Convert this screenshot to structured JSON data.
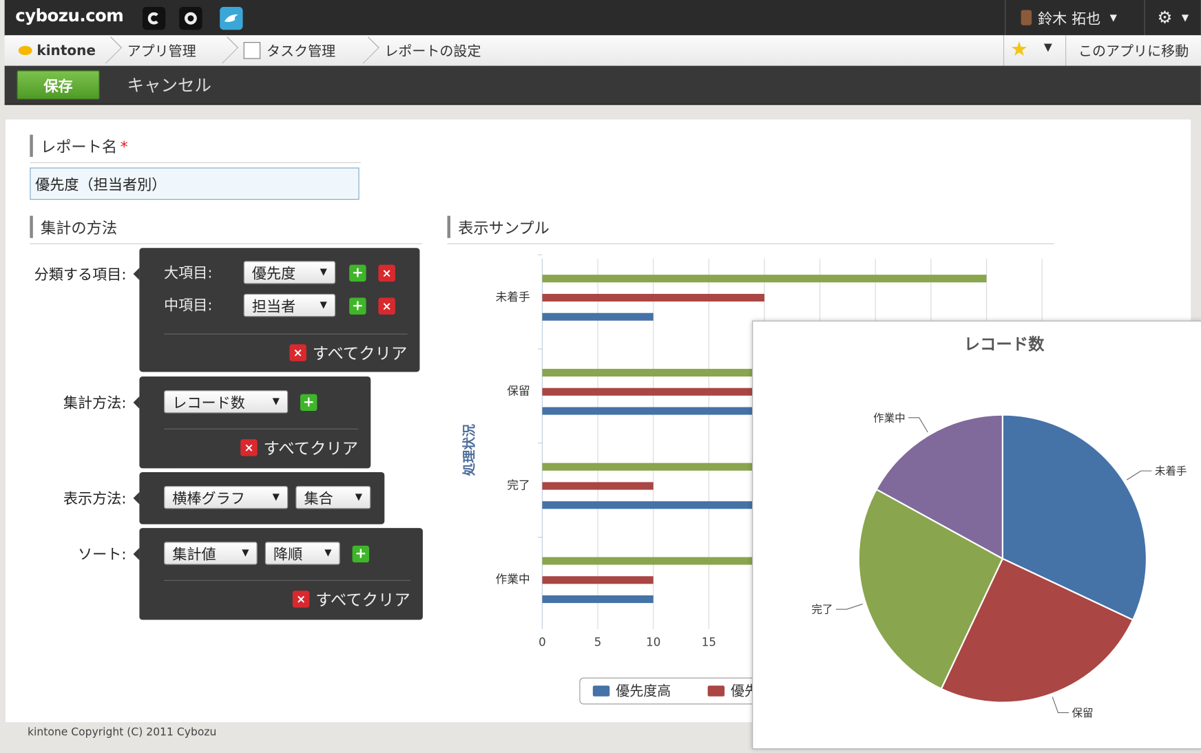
{
  "topbar": {
    "logo": "cybozu.com",
    "icons": [
      "c-icon",
      "circle-icon",
      "bird-icon"
    ],
    "user_name": "鈴木 拓也",
    "user_caret": "▼",
    "gear_symbol": "⚙",
    "gear_caret": "▼"
  },
  "breadcrumb": {
    "home": "kintone",
    "items": [
      "アプリ管理",
      "タスク管理",
      "レポートの設定"
    ],
    "star": "★",
    "star_caret": "▼",
    "goto_app": "このアプリに移動"
  },
  "actions": {
    "save": "保存",
    "cancel": "キャンセル"
  },
  "report": {
    "name_label": "レポート名",
    "required_mark": "*",
    "name_value": "優先度（担当者別）"
  },
  "aggregation": {
    "section_title": "集計の方法",
    "group_label": "分類する項目:",
    "major_label": "大項目:",
    "major_value": "優先度",
    "minor_label": "中項目:",
    "minor_value": "担当者",
    "clear_all": "すべてクリア",
    "method_label": "集計方法:",
    "method_value": "レコード数",
    "display_label": "表示方法:",
    "display_type": "横棒グラフ",
    "display_mode": "集合",
    "sort_label": "ソート:",
    "sort_field": "集計値",
    "sort_order": "降順",
    "caret": "▼",
    "plus": "+",
    "x": "×"
  },
  "sample": {
    "section_title": "表示サンプル"
  },
  "chart_data": [
    {
      "type": "bar",
      "orientation": "horizontal",
      "ylabel": "処理状況",
      "categories": [
        "未着手",
        "保留",
        "完了",
        "作業中"
      ],
      "xticks": [
        "0",
        "5",
        "10",
        "15"
      ],
      "xlim": [
        0,
        45
      ],
      "grid": true,
      "series": [
        {
          "name": "優先度高",
          "color": "#4572a7",
          "values": [
            10,
            20,
            20,
            10
          ]
        },
        {
          "name": "優先",
          "color": "#aa4643",
          "values": [
            20,
            20,
            10,
            10
          ]
        },
        {
          "name": "",
          "color": "#89a54e",
          "values": [
            40,
            25,
            25,
            25
          ]
        }
      ],
      "legend_position": "bottom"
    },
    {
      "type": "pie",
      "title": "レコード数",
      "labels": [
        "未着手",
        "保留",
        "完了",
        "作業中"
      ],
      "values": [
        32,
        25,
        26,
        17
      ],
      "colors": [
        "#4572a7",
        "#aa4643",
        "#89a54e",
        "#80699b"
      ]
    }
  ],
  "footer": {
    "copyright": "kintone Copyright (C) 2011 Cybozu"
  }
}
